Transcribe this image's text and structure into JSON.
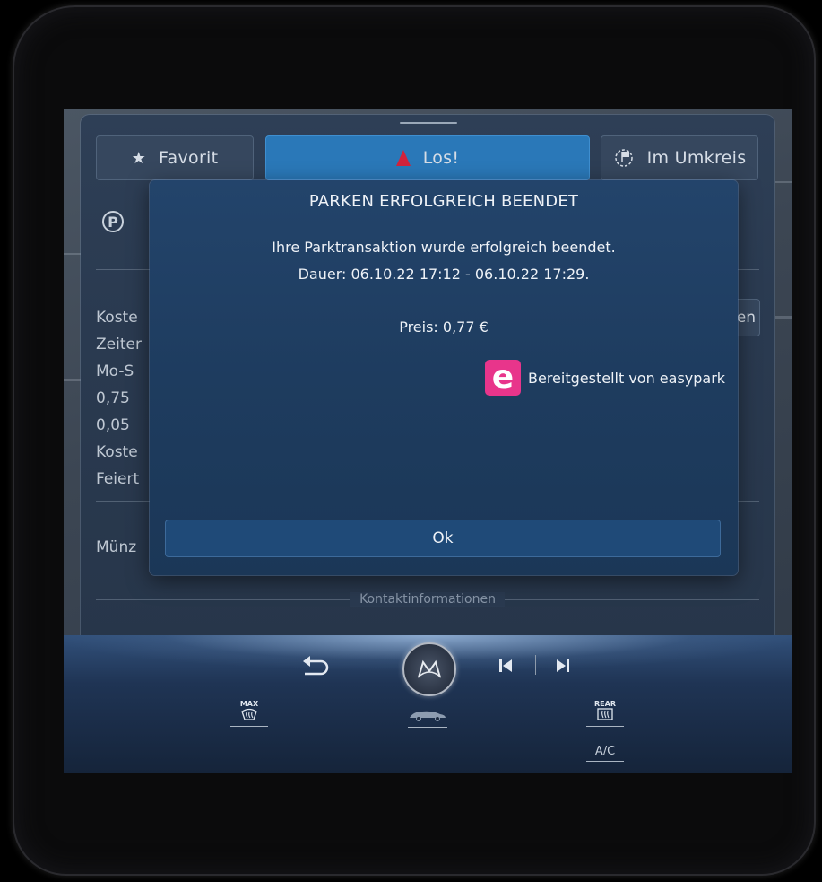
{
  "tabs": {
    "favorite": "Favorit",
    "go": "Los!",
    "nearby": "Im Umkreis"
  },
  "background": {
    "lines": [
      "Koste",
      "Zeiter",
      "Mo-S",
      "0,75",
      "0,05",
      "Koste",
      "Feiert",
      "Münz"
    ],
    "route_button": "open",
    "contact_divider": "Kontaktinformationen"
  },
  "dialog": {
    "title": "PARKEN ERFOLGREICH BEENDET",
    "message": "Ihre Parktransaktion wurde erfolgreich beendet.",
    "duration": "Dauer: 06.10.22 17:12 - 06.10.22 17:29.",
    "price": "Preis: 0,77 €",
    "provider_logo_letter": "e",
    "provider": "Bereitgestellt von easypark",
    "ok_button": "Ok",
    "accent": "#e8358b"
  },
  "dock": {
    "max_label": "MAX",
    "rear_label": "REAR",
    "ac_label": "A/C",
    "icons": [
      "back-icon",
      "home-icon",
      "previous-track-icon",
      "next-track-icon",
      "front-defrost-icon",
      "drive-mode-icon",
      "rear-defrost-icon"
    ]
  }
}
